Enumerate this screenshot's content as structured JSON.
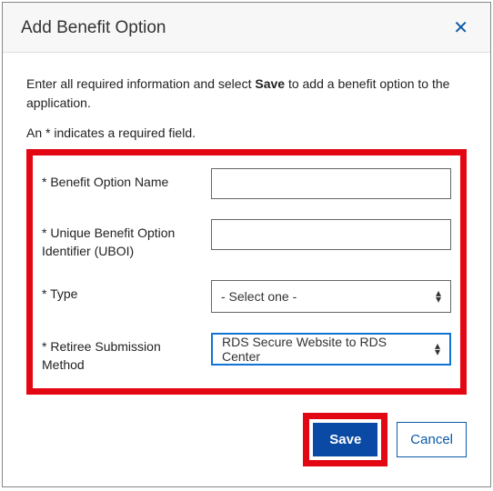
{
  "dialog": {
    "title": "Add Benefit Option",
    "intro_pre": "Enter all required information and select ",
    "intro_bold": "Save",
    "intro_post": " to add a benefit option to the application.",
    "required_hint": "An * indicates a required field."
  },
  "fields": {
    "benefit_name": {
      "label": "* Benefit Option Name",
      "value": ""
    },
    "uboi": {
      "label": "* Unique Benefit Option Identifier (UBOI)",
      "value": ""
    },
    "type": {
      "label": "* Type",
      "selected": "- Select one -"
    },
    "submission": {
      "label": "* Retiree Submission Method",
      "selected": "RDS Secure Website to RDS Center"
    }
  },
  "buttons": {
    "save": "Save",
    "cancel": "Cancel"
  },
  "icons": {
    "close": "✕",
    "caret": "▴\n▾"
  }
}
